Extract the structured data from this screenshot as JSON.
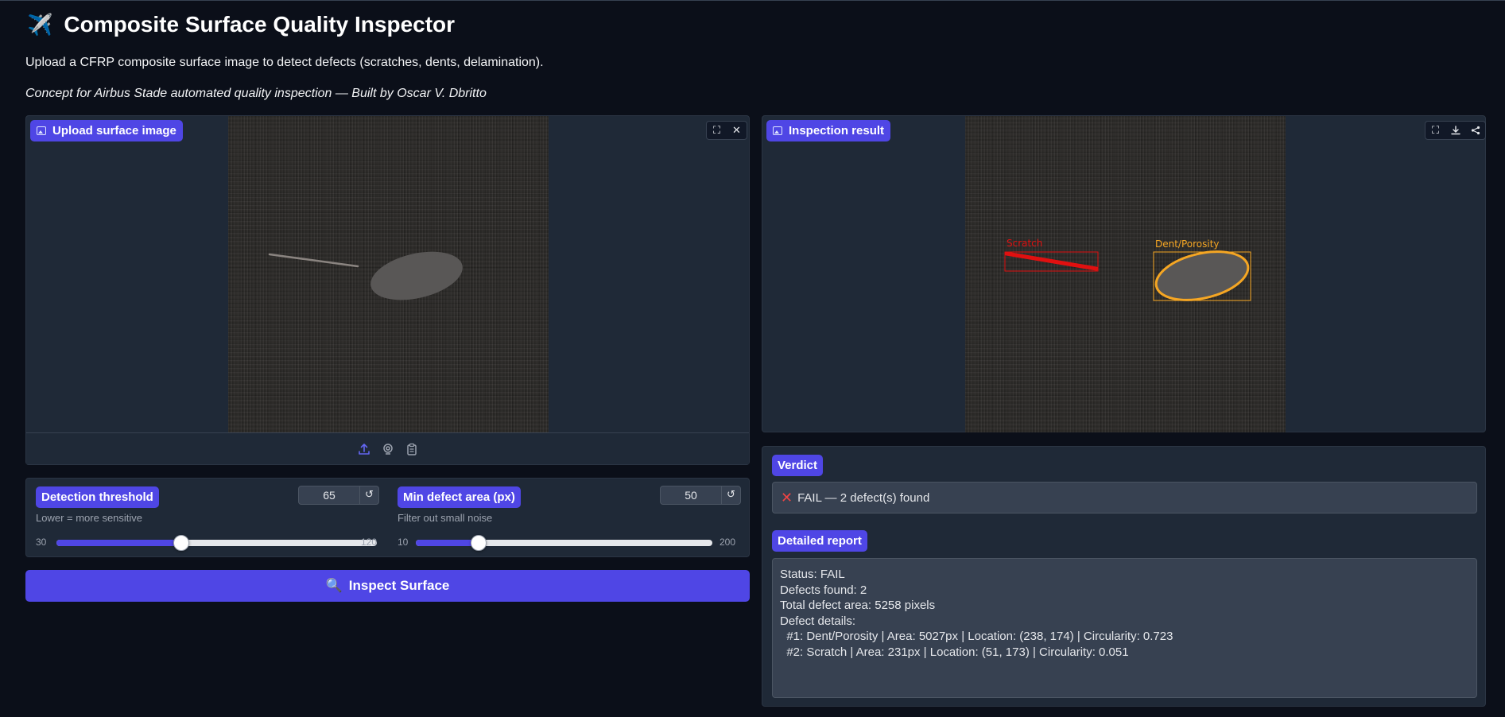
{
  "header": {
    "icon": "airplane-icon",
    "title": "Composite Surface Quality Inspector",
    "subtitle": "Upload a CFRP composite surface image to detect defects (scratches, dents, delamination).",
    "credit": "Concept for Airbus Stade automated quality inspection — Built by Oscar V. Dbritto"
  },
  "upload_panel": {
    "label": "Upload surface image",
    "toolbar": [
      "fullscreen-icon",
      "close-icon"
    ],
    "sources": [
      "upload-icon",
      "webcam-icon",
      "clipboard-icon"
    ]
  },
  "result_panel": {
    "label": "Inspection result",
    "toolbar": [
      "fullscreen-icon",
      "download-icon",
      "share-icon"
    ],
    "annotations": {
      "scratch_label": "Scratch",
      "dent_label": "Dent/Porosity",
      "scratch_color": "#e01010",
      "dent_color": "#f5a623"
    }
  },
  "controls": {
    "threshold": {
      "label": "Detection threshold",
      "value": "65",
      "hint": "Lower = more sensitive",
      "min": "30",
      "max": "120",
      "fraction": 0.3889
    },
    "min_area": {
      "label": "Min defect area (px)",
      "value": "50",
      "hint": "Filter out small noise",
      "min": "10",
      "max": "200",
      "fraction": 0.2105
    },
    "inspect_button": "Inspect Surface",
    "inspect_icon": "magnifier-icon"
  },
  "verdict": {
    "label": "Verdict",
    "text": "FAIL — 2 defect(s) found",
    "icon": "cross-icon"
  },
  "report": {
    "label": "Detailed report",
    "lines": [
      "Status: FAIL",
      "Defects found: 2",
      "Total defect area: 5258 pixels",
      "",
      "Defect details:",
      "  #1: Dent/Porosity | Area: 5027px | Location: (238, 174) | Circularity: 0.723",
      "  #2: Scratch | Area: 231px | Location: (51, 173) | Circularity: 0.051"
    ]
  },
  "colors": {
    "background": "#0b0f19",
    "panel": "#1f2937",
    "accent": "#4f46e5",
    "fail": "#ef4444"
  }
}
